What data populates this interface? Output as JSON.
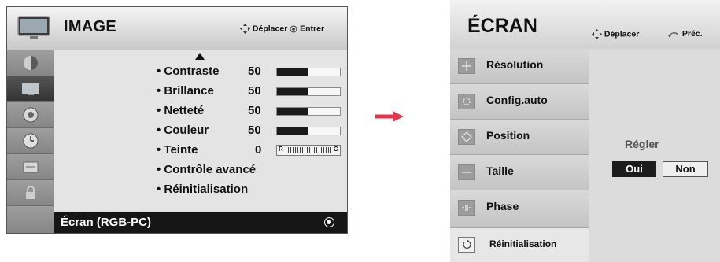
{
  "left_menu": {
    "title": "IMAGE",
    "hint_move": "Déplacer",
    "hint_enter": "Entrer",
    "side_icons": [
      "picture-icon",
      "tv-screen-icon",
      "speaker-icon",
      "clock-icon",
      "lock-keyboard-icon",
      "padlock-icon"
    ],
    "items": [
      {
        "label": "• Contraste",
        "value": "50",
        "level": 50
      },
      {
        "label": "• Brillance",
        "value": "50",
        "level": 50
      },
      {
        "label": "• Netteté",
        "value": "50",
        "level": 50
      },
      {
        "label": "• Couleur",
        "value": "50",
        "level": 50
      },
      {
        "label": "• Teinte",
        "value": "0",
        "tint_left": "R",
        "tint_right": "G"
      }
    ],
    "advanced": "• Contrôle avancé",
    "reset": "• Réinitialisation",
    "selected": "Écran (RGB-PC)"
  },
  "right_menu": {
    "title": "ÉCRAN",
    "hint_move": "Déplacer",
    "hint_prev": "Préc.",
    "items": [
      {
        "label": "Résolution",
        "icon": "plus-icon"
      },
      {
        "label": "Config.auto",
        "icon": "circle-icon"
      },
      {
        "label": "Position",
        "icon": "diamond-icon"
      },
      {
        "label": "Taille",
        "icon": "minus-icon"
      },
      {
        "label": "Phase",
        "icon": "phase-icon"
      }
    ],
    "reset": "Réinitialisation",
    "adjust_label": "Régler",
    "yes": "Oui",
    "no": "Non"
  },
  "colors": {
    "arrow": "#e8334f",
    "selected_bg": "#161616"
  }
}
